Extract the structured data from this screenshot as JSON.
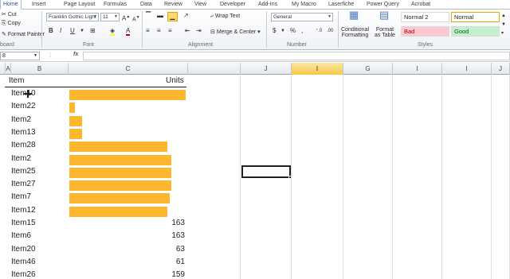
{
  "ribbon_tabs": [
    "Home",
    "Insert",
    "Page Layout",
    "Formulas",
    "Data",
    "Review",
    "View",
    "Developer",
    "Add-Ins",
    "My Macro",
    "Laserfiche",
    "Power Query",
    "Acrobat"
  ],
  "clipboard": {
    "cut": "Cut",
    "copy": "Copy",
    "format_painter": "Format Painter",
    "group_label": "board"
  },
  "font": {
    "name": "Franklin Gothic Light",
    "size": "11",
    "group_label": "Font"
  },
  "alignment": {
    "wrap_text": "Wrap Text",
    "merge_center": "Merge & Center",
    "group_label": "Alignment"
  },
  "number": {
    "format": "General",
    "group_label": "Number"
  },
  "styles_group": {
    "conditional_formatting": [
      "Conditional",
      "Formatting"
    ],
    "format_as_table": [
      "Format",
      "as Table"
    ],
    "cells": [
      {
        "label": "Normal 2",
        "bg": "#ffffff",
        "fg": "#1f1f1f"
      },
      {
        "label": "Normal",
        "bg": "#ffffff",
        "fg": "#1f1f1f"
      },
      {
        "label": "Bad",
        "bg": "#ffc7ce",
        "fg": "#9c0006"
      },
      {
        "label": "Good",
        "bg": "#c6efce",
        "fg": "#006100"
      }
    ],
    "group_label": "Styles"
  },
  "formula_bar": {
    "name_box": "8",
    "fx": "fx",
    "formula": ""
  },
  "columns": [
    "A",
    "B",
    "C",
    "",
    "J",
    "I",
    "G",
    "I",
    "I",
    "J"
  ],
  "selected_column": "I",
  "table_header": {
    "item": "Item",
    "units": "Units"
  },
  "accent_color": "#fdb72e",
  "rows": [
    {
      "label": "Item10",
      "bar": 1.0
    },
    {
      "label": "Item22",
      "bar": 0.05
    },
    {
      "label": "Item2",
      "bar": 0.11
    },
    {
      "label": "Item13",
      "bar": 0.11
    },
    {
      "label": "Item28",
      "bar": 0.84
    },
    {
      "label": "Item2",
      "bar": 0.88
    },
    {
      "label": "Item25",
      "bar": 0.88
    },
    {
      "label": "Item27",
      "bar": 0.88
    },
    {
      "label": "Item7",
      "bar": 0.86
    },
    {
      "label": "Item12",
      "bar": 0.84
    },
    {
      "label": "Item15",
      "value": "163"
    },
    {
      "label": "Item6",
      "value": "163"
    },
    {
      "label": "Item20",
      "value": "63"
    },
    {
      "label": "Item46",
      "value": "61"
    },
    {
      "label": "Item26",
      "value": "159"
    }
  ]
}
